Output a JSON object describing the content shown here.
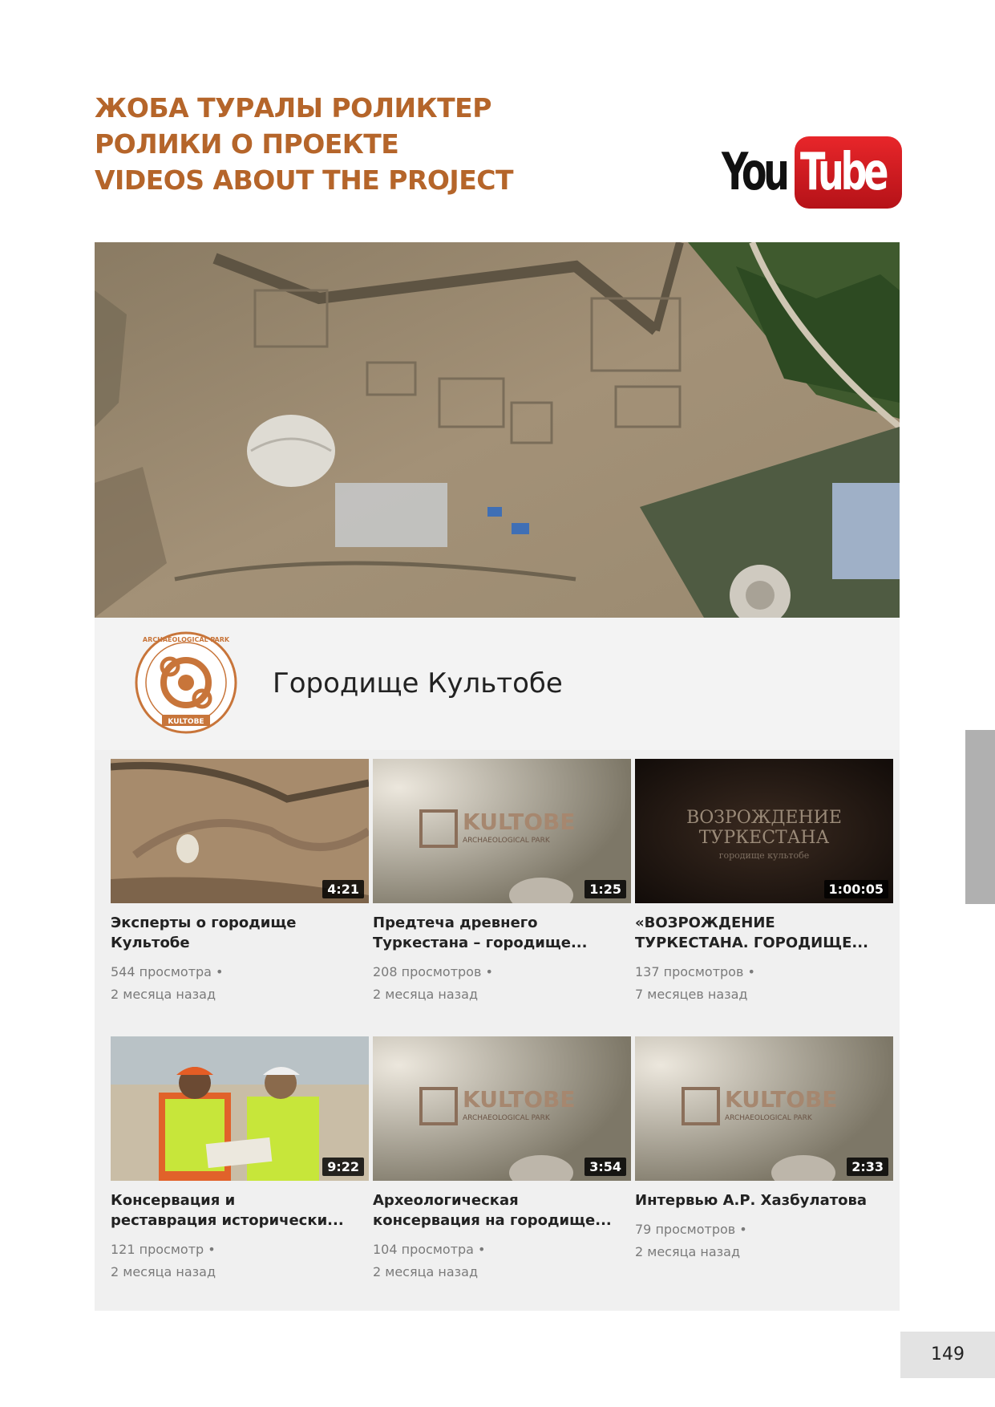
{
  "heading": {
    "line1": "ЖОБА ТУРАЛЫ РОЛИКТЕР",
    "line2": "РОЛИКИ О ПРОЕКТЕ",
    "line3": "VIDEOS ABOUT THE PROJECT",
    "color": "#b5652a"
  },
  "youtube_logo": {
    "you": "You",
    "tube": "Tube",
    "icon": "youtube-logo"
  },
  "channel": {
    "name": "Городище Культобе",
    "logo_arc_text": "ARCHAEOLOGICAL PARK",
    "logo_banner_text": "KULTOBE"
  },
  "videos": [
    {
      "title1": "Эксперты о городище",
      "title2": "Культобе",
      "views": "544 просмотра •",
      "age": "2 месяца назад",
      "duration": "4:21",
      "thumb": "aerial-excavation"
    },
    {
      "title1": "Предтеча древнего",
      "title2": "Туркестана – городище...",
      "views": "208 просмотров •",
      "age": "2 месяца назад",
      "duration": "1:25",
      "thumb": "kultobe-logo-aerial",
      "thumb_text": "KULTOBE",
      "thumb_sub": "ARCHAEOLOGICAL PARK"
    },
    {
      "title1": "«ВОЗРОЖДЕНИЕ",
      "title2": "ТУРКЕСТАНА. ГОРОДИЩЕ...",
      "views": "137 просмотров •",
      "age": "7 месяцев назад",
      "duration": "1:00:05",
      "thumb": "title-card",
      "thumb_line1": "ВОЗРОЖДЕНИЕ",
      "thumb_line2": "ТУРКЕСТАНА",
      "thumb_line3": "городище культобе"
    },
    {
      "title1": "Консервация и",
      "title2": "реставрация исторически...",
      "views": "121 просмотр •",
      "age": "2 месяца назад",
      "duration": "9:22",
      "thumb": "workers-in-vests"
    },
    {
      "title1": "Археологическая",
      "title2": "консервация на городище...",
      "views": "104 просмотра •",
      "age": "2 месяца назад",
      "duration": "3:54",
      "thumb": "kultobe-logo-aerial",
      "thumb_text": "KULTOBE",
      "thumb_sub": "ARCHAEOLOGICAL PARK"
    },
    {
      "title1": "Интервью А.Р. Хазбулатова",
      "title2": "",
      "views": "79 просмотров •",
      "age": "2 месяца назад",
      "duration": "2:33",
      "thumb": "kultobe-logo-aerial",
      "thumb_text": "KULTOBE",
      "thumb_sub": "ARCHAEOLOGICAL PARK"
    }
  ],
  "page_number": "149"
}
